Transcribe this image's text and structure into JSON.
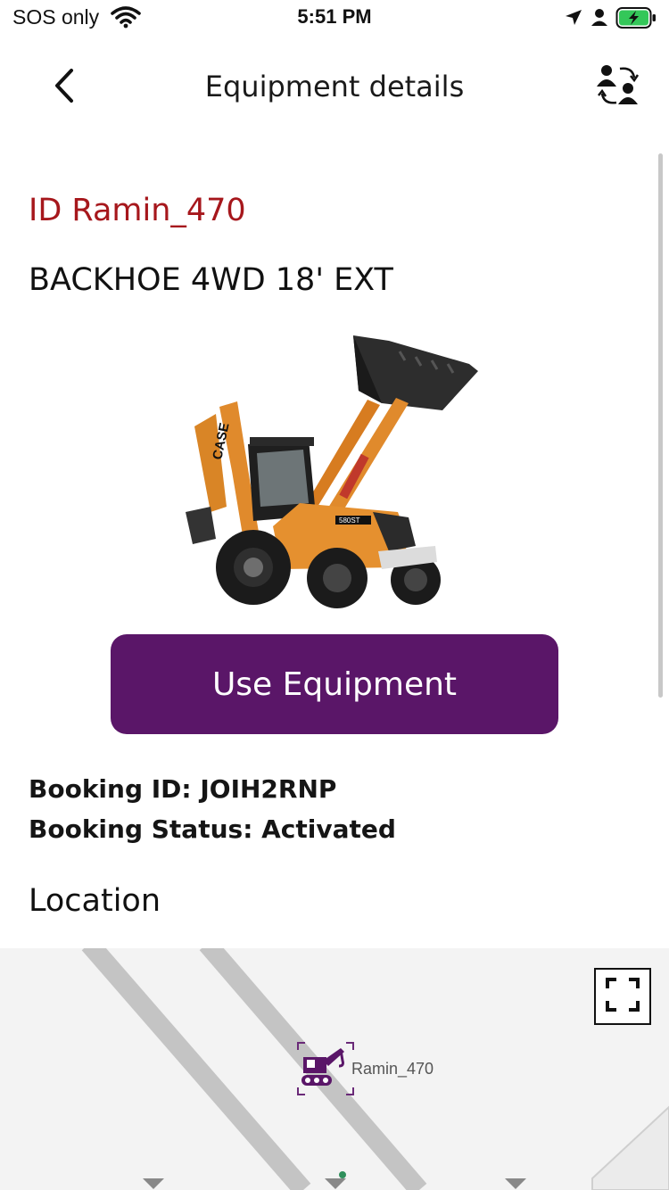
{
  "status_bar": {
    "carrier": "SOS only",
    "time": "5:51 PM"
  },
  "nav": {
    "title": "Equipment details",
    "back_icon": "chevron-left-icon",
    "swap_icon": "swap-users-icon"
  },
  "equipment": {
    "id_text": "ID Ramin_470",
    "name": "BACKHOE 4WD 18' EXT",
    "image_alt": "backhoe-loader-image"
  },
  "actions": {
    "use_label": "Use Equipment"
  },
  "booking": {
    "id_text": "Booking ID: JOIH2RNP",
    "status_text": "Booking Status: Activated"
  },
  "location": {
    "heading": "Location",
    "marker_label": "Ramin_470",
    "fullscreen_icon": "fullscreen-icon"
  },
  "colors": {
    "accent": "#a6171c",
    "primary_button": "#5a1668",
    "battery_green": "#34c759"
  }
}
